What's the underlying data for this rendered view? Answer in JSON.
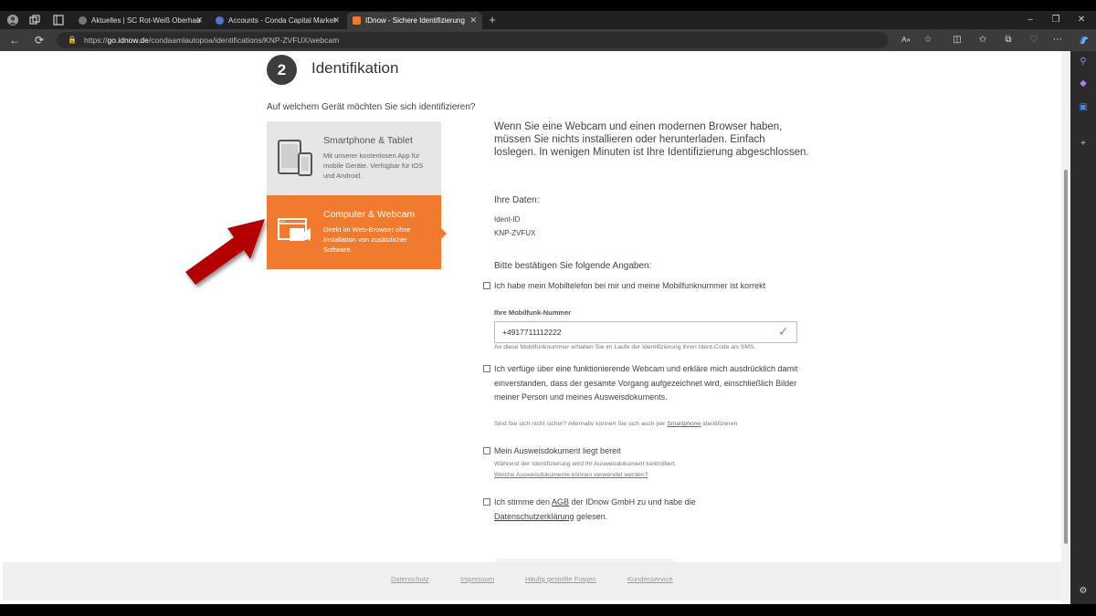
{
  "browser": {
    "tabs": [
      {
        "label": "Aktuelles | SC Rot-Weiß Oberhau",
        "fav_color": "#777777"
      },
      {
        "label": "Accounts - Conda Capital Market",
        "fav_color": "#4a7bd0"
      },
      {
        "label": "IDnow - Sichere Identifizierung",
        "fav_color": "#f07b2f"
      }
    ],
    "url_prefix": "https://",
    "url_host": "go.idnow.de",
    "url_path": "/condaamlautopoa/identifications/KNP-ZVFUX/webcam"
  },
  "step": {
    "number": "2",
    "title": "Identifikation"
  },
  "device_question": "Auf welchem Gerät möchten Sie sich identifizieren?",
  "options": {
    "phone": {
      "title": "Smartphone & Tablet",
      "desc": "Mit unserer kostenlosen App für mobile Geräte. Verfügbar für iOS und Android."
    },
    "webcam": {
      "title": "Computer & Webcam",
      "desc": "Direkt im Web-Browser ohne Installation von zusätzlicher Software."
    }
  },
  "intro": "Wenn Sie eine Webcam und einen modernen Browser haben, müssen Sie nichts installieren oder herunterladen. Einfach loslegen. In wenigen Minuten ist Ihre Identifizierung abgeschlossen.",
  "your_data": {
    "heading": "Ihre Daten:",
    "ident_label": "Ident-ID",
    "ident_value": "KNP-ZVFUX"
  },
  "confirm_heading": "Bitte bestätigen Sie folgende Angaben:",
  "checks": {
    "mobile": {
      "text": "Ich habe mein Mobiltelefon bei mir und meine Mobilfunknummer ist korrekt"
    },
    "phone_label": "Ihre Mobilfunk-Nummer",
    "phone_value": "+4917711112222",
    "phone_hint": "An diese Mobilfunknummer erhalten Sie im Laufe der Identifizierung Ihren Ident-Code als SMS.",
    "webcam": {
      "text": "Ich verfüge über eine funktionierende Webcam und erkläre mich ausdrücklich damit einverstanden, dass der gesamte Vorgang aufgezeichnet wird, einschließlich Bilder meiner Person und meines Ausweisdokuments."
    },
    "webcam_hint_pre": "Sind Sie sich nicht sicher? Alternativ können Sie sich auch per",
    "webcam_hint_link": "Smartphone",
    "webcam_hint_post": "identifizieren",
    "document": {
      "text": "Mein Ausweisdokument liegt bereit"
    },
    "document_hint": "Während der Identifizierung wird Ihr Ausweisdokument kontrolliert.",
    "document_link": "Welche Ausweisdokumente können verwendet werden?",
    "agb_pre": "Ich stimme den",
    "agb_link": "AGB",
    "agb_mid": "der IDnow GmbH zu und habe die",
    "privacy_link": "Datenschutzerklärung",
    "agb_post": "gelesen."
  },
  "footer": {
    "links": [
      "Datenschutz",
      "Impressum",
      "Häufig gestellte Fragen",
      "Kundenservice"
    ]
  },
  "colors": {
    "accent": "#f07b2f",
    "arrow": "#b30000",
    "check": "#6aa84f"
  }
}
